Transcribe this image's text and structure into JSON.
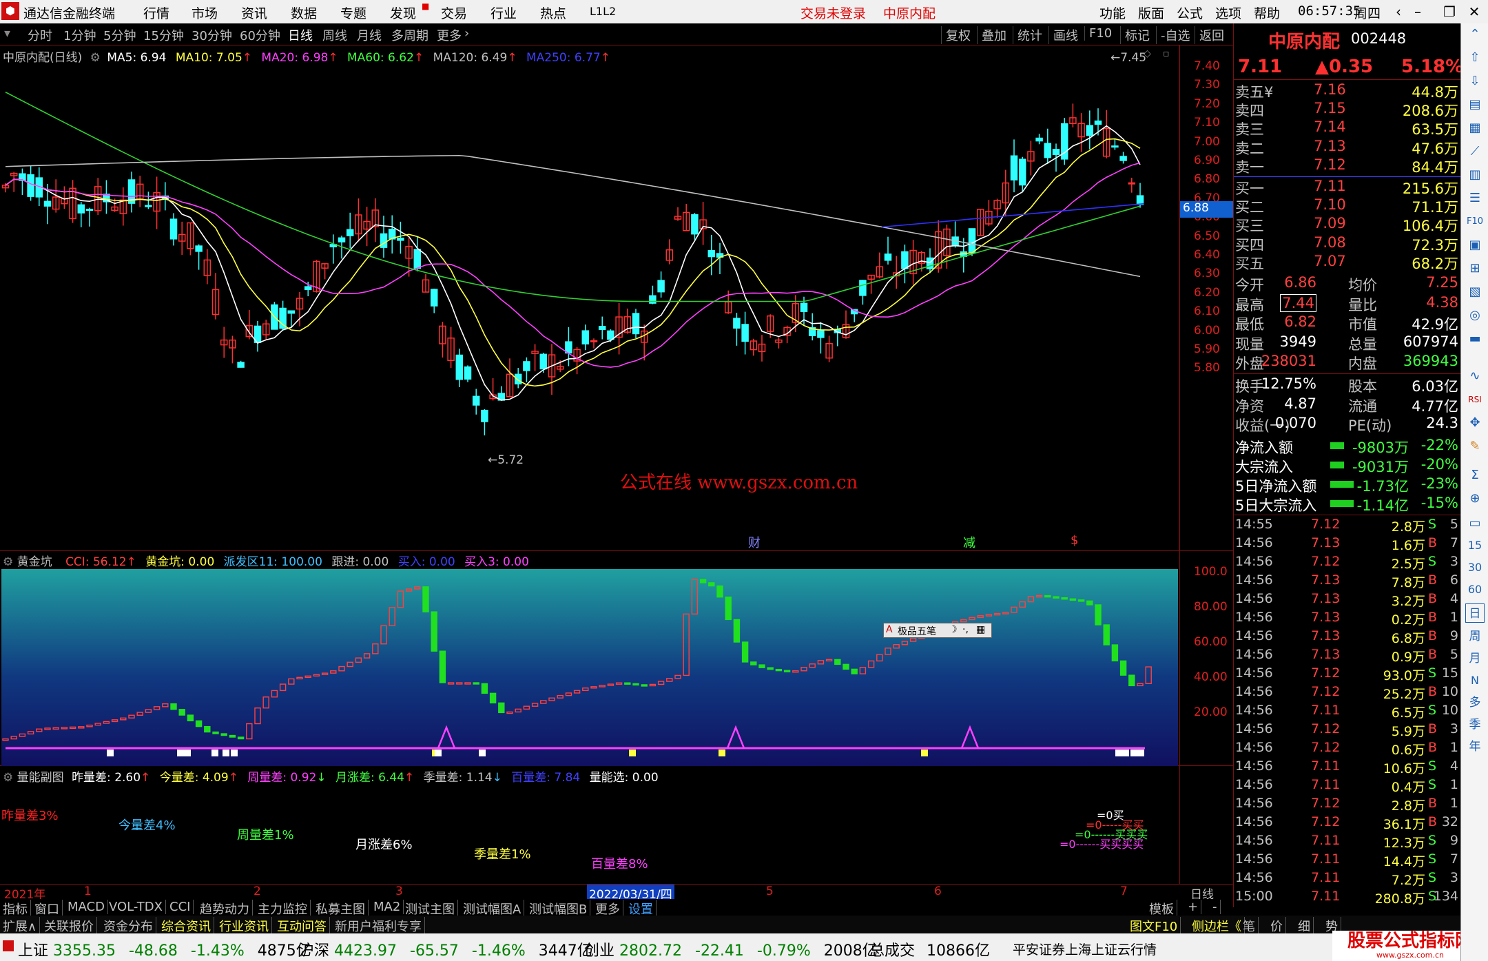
{
  "menubar": {
    "app_title": "通达信金融终端",
    "items": [
      "行情",
      "市场",
      "资讯",
      "数据",
      "专题",
      "发现",
      "交易",
      "行业",
      "热点",
      "L1L2"
    ],
    "status_red": [
      "交易未登录",
      "中原内配"
    ],
    "right_items": [
      "功能",
      "版面",
      "公式",
      "选项",
      "帮助"
    ],
    "clock": "06:57:35",
    "weekday": "周四"
  },
  "periodbar": {
    "items": [
      "分时",
      "1分钟",
      "5分钟",
      "15分钟",
      "30分钟",
      "60分钟",
      "日线",
      "周线",
      "月线",
      "多周期",
      "更多"
    ],
    "active": "日线",
    "tools": [
      "复权",
      "叠加",
      "统计",
      "画线",
      "F10",
      "标记",
      "-自选",
      "返回"
    ]
  },
  "main_chart": {
    "title": "中原内配(日线)",
    "ma_labels": [
      {
        "text": "MA5: 6.94",
        "color": "#ffffff"
      },
      {
        "text": "MA10: 7.05",
        "color": "#ffff40"
      },
      {
        "text": "MA20: 6.98",
        "color": "#ff40ff"
      },
      {
        "text": "MA60: 6.62",
        "color": "#40ff40"
      },
      {
        "text": "MA120: 6.49",
        "color": "#c0c0c0"
      },
      {
        "text": "MA250: 6.77",
        "color": "#4040ff"
      }
    ],
    "y_ticks": [
      "7.40",
      "7.30",
      "7.20",
      "7.10",
      "7.00",
      "6.90",
      "6.80",
      "6.70",
      "6.60",
      "6.50",
      "6.40",
      "6.30",
      "6.20",
      "6.10",
      "6.00",
      "5.90",
      "5.80"
    ],
    "current_price_tag": "6.88",
    "high_marker": "7.45",
    "low_marker": "5.72",
    "watermark": "公式在线  www.gszx.com.cn",
    "event_marks": [
      "财",
      "减",
      "$"
    ]
  },
  "indicator1": {
    "name": "黄金坑",
    "fields": [
      {
        "text": "CCI: 56.12",
        "color": "#ff4040"
      },
      {
        "text": "黄金坑: 0.00",
        "color": "#ffff40"
      },
      {
        "text": "派发区11: 100.00",
        "color": "#40c0ff"
      },
      {
        "text": "跟进: 0.00",
        "color": "#c0c0c0"
      },
      {
        "text": "买入: 0.00",
        "color": "#4040ff"
      },
      {
        "text": "买入3: 0.00",
        "color": "#ff40ff"
      }
    ],
    "y_ticks": [
      "100.0",
      "80.00",
      "60.00",
      "40.00",
      "20.00"
    ],
    "ime_box": "极品五笔"
  },
  "indicator2": {
    "name": "量能副图",
    "fields": [
      {
        "text": "昨量差: 2.60",
        "color": "#ffffff"
      },
      {
        "text": "今量差: 4.09",
        "color": "#ffff40"
      },
      {
        "text": "周量差: 0.92",
        "color": "#ff40ff"
      },
      {
        "text": "月涨差: 6.44",
        "color": "#40ff40"
      },
      {
        "text": "季量差: 1.14",
        "color": "#c0c0c0"
      },
      {
        "text": "百量差: 7.84",
        "color": "#4040ff"
      },
      {
        "text": "量能选: 0.00",
        "color": "#ffffff"
      }
    ],
    "labels": [
      {
        "text": "昨量差3%",
        "color": "#ff2020"
      },
      {
        "text": "今量差4%",
        "color": "#40c0ff"
      },
      {
        "text": "周量差1%",
        "color": "#40ff40"
      },
      {
        "text": "月涨差6%",
        "color": "#ffffff"
      },
      {
        "text": "季量差1%",
        "color": "#ffff40"
      },
      {
        "text": "百量差8%",
        "color": "#ff40ff"
      }
    ],
    "right_texts": [
      "=0买",
      "=0-----买买",
      "=0------买买买",
      "=0------买买买买"
    ]
  },
  "time_axis": {
    "labels": [
      "2021年",
      "1",
      "2",
      "3",
      "2022/03/31/四",
      "5",
      "6",
      "7"
    ],
    "right_label": "日线"
  },
  "bottom_tabs": {
    "items": [
      "指标",
      "窗口",
      "MACD",
      "VOL-TDX",
      "CCI",
      "趋势动力",
      "主力监控",
      "私募主图",
      "MA2",
      "测试主图",
      "测试幅图A",
      "测试幅图B",
      "更多",
      "设置"
    ],
    "right": [
      "模板",
      "+",
      "-"
    ]
  },
  "bottom_bar2": {
    "items": [
      "扩展∧",
      "关联报价",
      "资金分布",
      "综合资讯",
      "行业资讯",
      "互动问答",
      "新用户福利专享"
    ],
    "right": [
      "图文F10",
      "侧边栏《",
      "笔",
      "价",
      "细",
      "势"
    ]
  },
  "quote": {
    "name": "中原内配",
    "code": "002448",
    "price": "7.11",
    "change": "▲0.35",
    "pct": "5.18%",
    "asks": [
      {
        "label": "卖五¥",
        "price": "7.16",
        "vol": "44.8万"
      },
      {
        "label": "卖四",
        "price": "7.15",
        "vol": "208.6万"
      },
      {
        "label": "卖三",
        "price": "7.14",
        "vol": "63.5万"
      },
      {
        "label": "卖二",
        "price": "7.13",
        "vol": "47.6万"
      },
      {
        "label": "卖一",
        "price": "7.12",
        "vol": "84.4万"
      }
    ],
    "bids": [
      {
        "label": "买一",
        "price": "7.11",
        "vol": "215.6万"
      },
      {
        "label": "买二",
        "price": "7.10",
        "vol": "71.1万"
      },
      {
        "label": "买三",
        "price": "7.09",
        "vol": "106.4万"
      },
      {
        "label": "买四",
        "price": "7.08",
        "vol": "72.3万"
      },
      {
        "label": "买五",
        "price": "7.07",
        "vol": "68.2万"
      }
    ],
    "stats": [
      [
        "今开",
        "6.86",
        "均价",
        "7.25"
      ],
      [
        "最高",
        "7.44",
        "量比",
        "4.38"
      ],
      [
        "最低",
        "6.82",
        "市值",
        "42.9亿"
      ],
      [
        "现量",
        "3949",
        "总量",
        "607974"
      ],
      [
        "外盘",
        "238031",
        "内盘",
        "369943"
      ],
      [
        "换手",
        "12.75%",
        "股本",
        "6.03亿"
      ],
      [
        "净资",
        "4.87",
        "流通",
        "4.77亿"
      ],
      [
        "收益(一)",
        "0.070",
        "PE(动)",
        "24.3"
      ]
    ],
    "flows": [
      [
        "净流入额",
        "-9803万",
        "-22%"
      ],
      [
        "大宗流入",
        "-9031万",
        "-20%"
      ],
      [
        "5日净流入额",
        "-1.73亿",
        "-23%"
      ],
      [
        "5日大宗流入",
        "-1.14亿",
        "-15%"
      ]
    ],
    "ticks": [
      [
        "14:55",
        "7.12",
        "2.8万",
        "S",
        "5"
      ],
      [
        "14:56",
        "7.13",
        "1.6万",
        "B",
        "7"
      ],
      [
        "14:56",
        "7.12",
        "2.5万",
        "S",
        "3"
      ],
      [
        "14:56",
        "7.13",
        "7.8万",
        "B",
        "6"
      ],
      [
        "14:56",
        "7.13",
        "3.2万",
        "B",
        "4"
      ],
      [
        "14:56",
        "7.13",
        "0.2万",
        "B",
        "1"
      ],
      [
        "14:56",
        "7.13",
        "6.8万",
        "B",
        "9"
      ],
      [
        "14:56",
        "7.13",
        "0.9万",
        "B",
        "5"
      ],
      [
        "14:56",
        "7.12",
        "93.0万",
        "S",
        "15"
      ],
      [
        "14:56",
        "7.12",
        "25.2万",
        "B",
        "10"
      ],
      [
        "14:56",
        "7.11",
        "6.5万",
        "S",
        "10"
      ],
      [
        "14:56",
        "7.12",
        "5.9万",
        "B",
        "3"
      ],
      [
        "14:56",
        "7.12",
        "0.6万",
        "B",
        "1"
      ],
      [
        "14:56",
        "7.11",
        "10.6万",
        "S",
        "4"
      ],
      [
        "14:56",
        "7.11",
        "0.4万",
        "S",
        "1"
      ],
      [
        "14:56",
        "7.12",
        "2.8万",
        "B",
        "1"
      ],
      [
        "14:56",
        "7.12",
        "36.1万",
        "B",
        "32"
      ],
      [
        "14:56",
        "7.11",
        "12.3万",
        "S",
        "9"
      ],
      [
        "14:56",
        "7.11",
        "14.4万",
        "S",
        "7"
      ],
      [
        "14:56",
        "7.11",
        "7.2万",
        "S",
        "3"
      ],
      [
        "15:00",
        "7.11",
        "280.8万",
        "S",
        "134"
      ]
    ]
  },
  "right_sidebar": {
    "side_labels": [
      "15",
      "30",
      "60",
      "日",
      "周",
      "月",
      "N",
      "多",
      "季",
      "年"
    ]
  },
  "statusbar": {
    "items": [
      {
        "name": "上证",
        "price": "3355.35",
        "chg": "-48.68",
        "pct": "-1.43%",
        "amt": "4875亿"
      },
      {
        "name": "沪深",
        "price": "4423.97",
        "chg": "-65.57",
        "pct": "-1.46%",
        "amt": "3447亿"
      },
      {
        "name": "创业",
        "price": "2802.72",
        "chg": "-22.41",
        "pct": "-0.79%",
        "amt": "2008亿"
      }
    ],
    "total_label": "总成交",
    "total": "10866亿",
    "broker": "平安证券上海上证云行情",
    "brand": "股票公式指标网",
    "brand_url": "www.gszx.com.cn"
  },
  "colors": {
    "up": "#ff3030",
    "down": "#30ffff",
    "ma5": "#ffffff",
    "ma10": "#ffff40",
    "ma20": "#ff40ff",
    "ma60": "#30d030",
    "ma120": "#c0c0c0",
    "ma250": "#3030ff"
  }
}
